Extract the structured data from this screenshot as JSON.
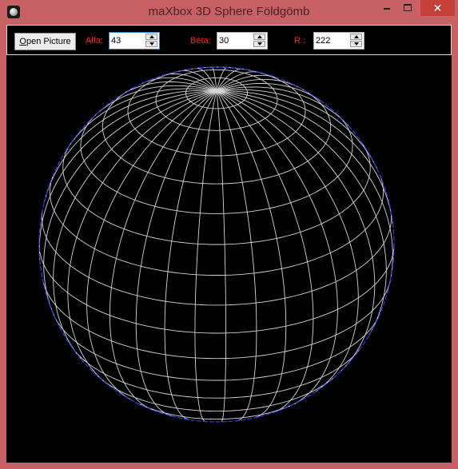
{
  "window": {
    "title": "maXbox 3D Sphere Földgömb",
    "controls": {
      "minimize": "",
      "maximize": "",
      "close": "✕"
    }
  },
  "toolbar": {
    "open_button_prefix": "O",
    "open_button_rest": "pen Picture",
    "alfa": {
      "label": "Alfa:",
      "value": "43"
    },
    "beta": {
      "label": "Béta:",
      "value": "30"
    },
    "radius": {
      "label": "R :",
      "value": "222"
    }
  },
  "sphere": {
    "alpha_deg": 43,
    "beta_deg": 30,
    "radius": 222,
    "grid_color": "#d6d6d6",
    "outline_color": "#3b3bd9",
    "background": "#000000"
  }
}
